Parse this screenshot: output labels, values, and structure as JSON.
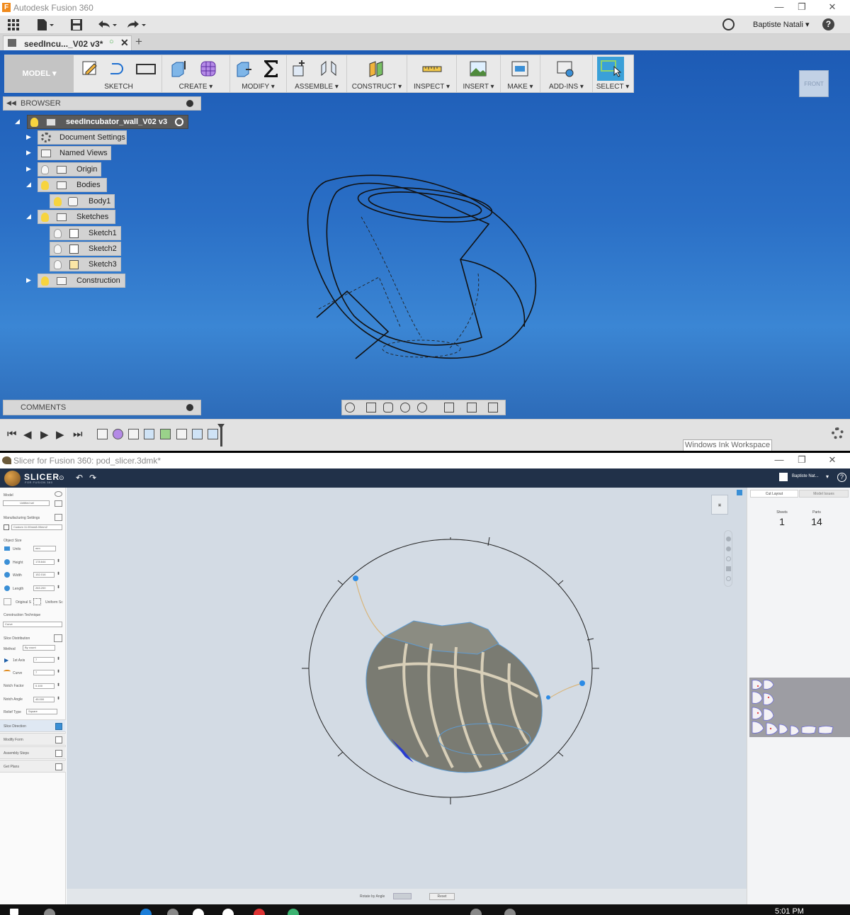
{
  "fusion": {
    "window_title": "Autodesk Fusion 360",
    "user": "Baptiste Natali",
    "user_caret": "▾",
    "help_label": "?",
    "doc_tab": "seedIncu..._V02 v3*",
    "workspace": "MODEL",
    "toolbar_groups": [
      "SKETCH",
      "CREATE",
      "MODIFY",
      "ASSEMBLE",
      "CONSTRUCT",
      "INSPECT",
      "INSERT",
      "MAKE",
      "ADD-INS",
      "SELECT"
    ],
    "viewcube_label": "FRONT",
    "browser_label": "BROWSER",
    "tree": [
      {
        "label": "seedIncubator_wall_V02 v3"
      },
      {
        "label": "Document Settings"
      },
      {
        "label": "Named Views"
      },
      {
        "label": "Origin"
      },
      {
        "label": "Bodies"
      },
      {
        "label": "Body1"
      },
      {
        "label": "Sketches"
      },
      {
        "label": "Sketch1"
      },
      {
        "label": "Sketch2"
      },
      {
        "label": "Sketch3"
      },
      {
        "label": "Construction"
      }
    ],
    "comments_label": "COMMENTS",
    "ink_workspace": "Windows Ink Workspace"
  },
  "slicer": {
    "window_title": "Slicer for Fusion 360: pod_slicer.3dmk*",
    "brand": "SLICER",
    "brand_sub": "FOR FUSION 360",
    "user": "Baptiste Nat...",
    "help_label": "?",
    "left": {
      "model_label": "Model",
      "model_value": "Untitled sel",
      "manufacturing_label": "Manufacturing Settings",
      "manufacturing_value": "Custom 11.00mm8.00mm2",
      "object_size_label": "Object Size",
      "units_label": "Units",
      "units_value": "mm",
      "height_label": "Height",
      "height_value": "178.644",
      "width_label": "Width",
      "width_value": "152.016",
      "length_label": "Length",
      "length_value": "263.200",
      "original_label": "Original S",
      "uniform_label": "Uniform Sc",
      "construction_label": "Construction Technique",
      "construction_value": "Curve",
      "slice_dist_label": "Slice Distribution",
      "method_label": "Method",
      "method_value": "By count",
      "axis1_label": "1st Axis",
      "axis1_value": "7",
      "curve_label": "Curve",
      "curve_value": "7",
      "notch_factor_label": "Notch Factor",
      "notch_factor_value": "0.100",
      "notch_angle_label": "Notch Angle",
      "notch_angle_value": "45.000",
      "relief_label": "Relief Type",
      "relief_value": "Square",
      "buttons": [
        "Slice Direction",
        "Modify Form",
        "Assembly Steps",
        "Get Plans"
      ]
    },
    "bottom": {
      "rotate_label": "Rotate by Angle",
      "reset_label": "Reset"
    },
    "right": {
      "tab_cut_layout": "Cut Layout",
      "tab_model_issues": "Model Issues",
      "sheets_label": "Sheets",
      "sheets_value": "1",
      "parts_label": "Parts",
      "parts_value": "14"
    }
  },
  "taskbar": {
    "time": "5:01 PM"
  }
}
